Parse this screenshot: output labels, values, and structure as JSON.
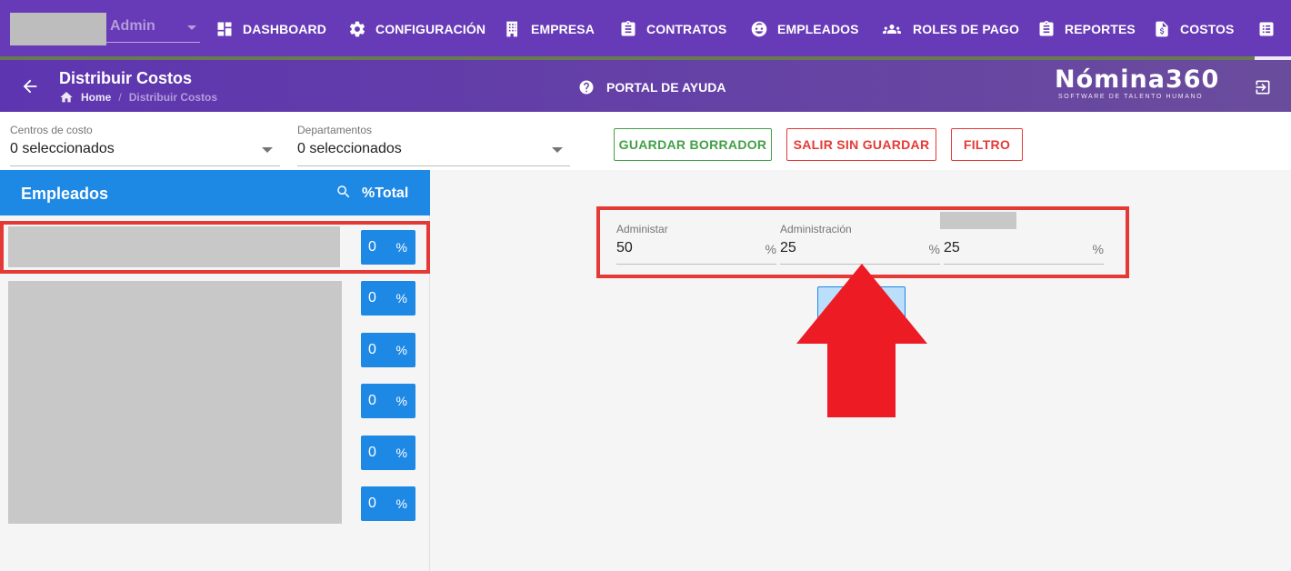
{
  "topnav": {
    "user": {
      "role": "Admin"
    },
    "items": [
      {
        "label": "DASHBOARD",
        "icon": "dashboard-icon"
      },
      {
        "label": "CONFIGURACIÓN",
        "icon": "gear-icon"
      },
      {
        "label": "EMPRESA",
        "icon": "building-icon"
      },
      {
        "label": "CONTRATOS",
        "icon": "clipboard-icon"
      },
      {
        "label": "EMPLEADOS",
        "icon": "face-icon"
      },
      {
        "label": "ROLES DE PAGO",
        "icon": "people-icon"
      },
      {
        "label": "REPORTES",
        "icon": "clipboard-icon"
      },
      {
        "label": "COSTOS",
        "icon": "file-dollar-icon"
      }
    ],
    "colors": {
      "background": "#673ab7",
      "progress": "#6a7a4f"
    }
  },
  "subheader": {
    "title": "Distribuir Costos",
    "breadcrumb": {
      "home": "Home",
      "separator": "/",
      "current": "Distribuir Costos"
    },
    "help_label": "PORTAL DE AYUDA",
    "brand": {
      "name": "Nómina360",
      "tagline": "SOFTWARE DE TALENTO HUMANO"
    }
  },
  "filters": {
    "centros": {
      "label": "Centros de costo",
      "value": "0 seleccionados"
    },
    "departamentos": {
      "label": "Departamentos",
      "value": "0 seleccionados"
    },
    "buttons": {
      "save_draft": "GUARDAR BORRADOR",
      "exit": "SALIR SIN GUARDAR",
      "filter": "FILTRO"
    }
  },
  "employees": {
    "title": "Empleados",
    "total_label": "%Total",
    "rows": [
      {
        "value": "0",
        "unit": "%"
      },
      {
        "value": "0",
        "unit": "%"
      },
      {
        "value": "0",
        "unit": "%"
      },
      {
        "value": "0",
        "unit": "%"
      },
      {
        "value": "0",
        "unit": "%"
      },
      {
        "value": "0",
        "unit": "%"
      }
    ]
  },
  "distribution": {
    "fields": [
      {
        "label": "Administar",
        "value": "50",
        "unit": "%"
      },
      {
        "label": "Administración",
        "value": "25",
        "unit": "%"
      },
      {
        "label": "",
        "value": "25",
        "unit": "%"
      }
    ]
  },
  "colors": {
    "accent_blue": "#1e88e5",
    "highlight_red": "#e53935",
    "success_green": "#43a047",
    "annotation_red": "#ed1c24"
  }
}
